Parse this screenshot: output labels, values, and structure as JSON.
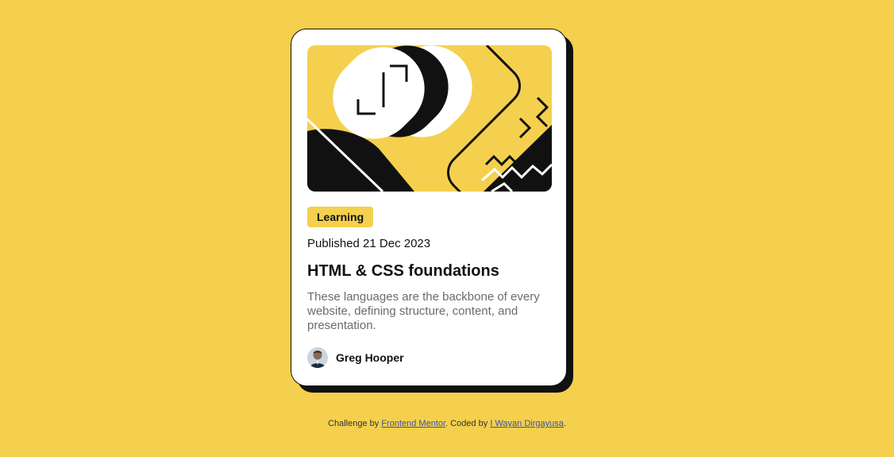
{
  "card": {
    "tag": "Learning",
    "published": "Published 21 Dec 2023",
    "title": "HTML & CSS foundations",
    "description": "These languages are the backbone of every website, defining structure, content, and presentation.",
    "author": "Greg Hooper",
    "hero_icon": "illustration-abstract",
    "avatar_icon": "avatar-photo"
  },
  "footer": {
    "prefix": "Challenge by ",
    "link1": "Frontend Mentor",
    "middle": ". Coded by ",
    "link2": "I Wayan Dirgayusa",
    "suffix": "."
  },
  "colors": {
    "background": "#F4D04E",
    "card": "#FFFFFF",
    "ink": "#111111",
    "muted": "#6B6B6B",
    "link": "#3E52A3"
  }
}
